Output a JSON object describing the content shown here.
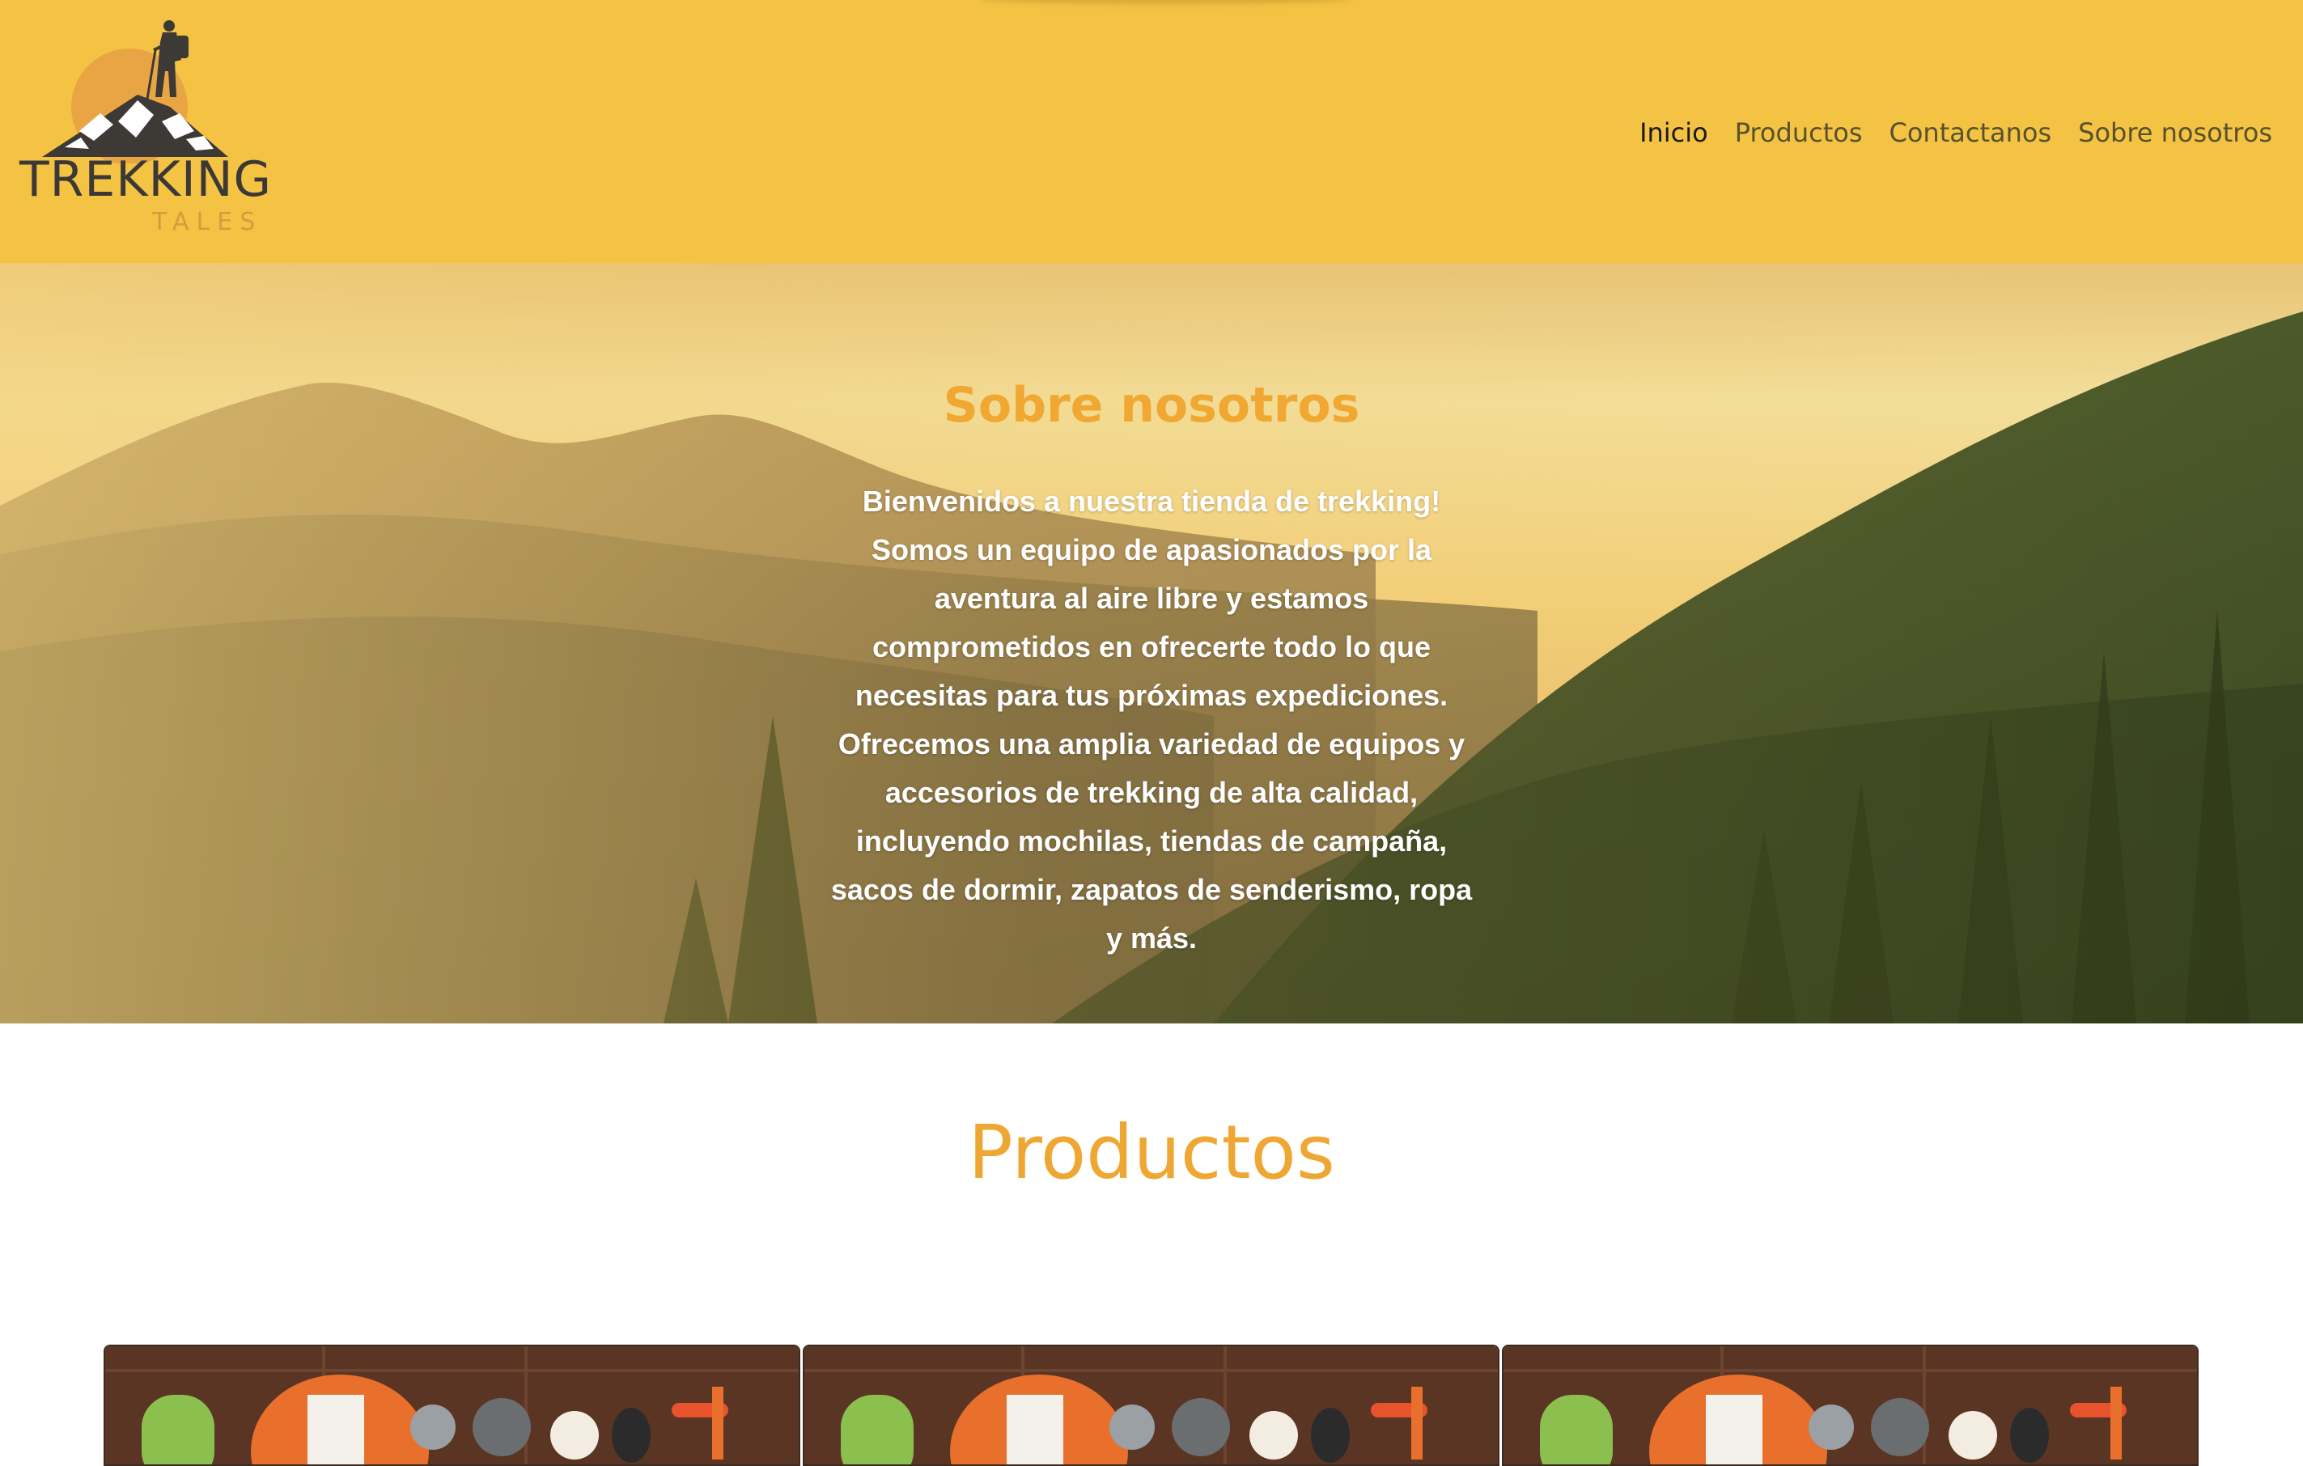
{
  "header": {
    "logo": {
      "title": "TREKKING",
      "subtitle": "TALES"
    },
    "nav": [
      {
        "label": "Inicio",
        "active": true
      },
      {
        "label": "Productos",
        "active": false
      },
      {
        "label": "Contactanos",
        "active": false
      },
      {
        "label": "Sobre nosotros",
        "active": false
      }
    ]
  },
  "hero": {
    "title": "Sobre nosotros",
    "text": "Bienvenidos a nuestra tienda de trekking! Somos un equipo de apasionados por la aventura al aire libre y estamos comprometidos en ofrecerte todo lo que necesitas para tus próximas expediciones. Ofrecemos una amplia variedad de equipos y accesorios de trekking de alta calidad, incluyendo mochilas, tiendas de campaña, sacos de dormir, zapatos de senderismo, ropa y más."
  },
  "products": {
    "title": "Productos",
    "cards": [
      {
        "image": "trekking-gear-photo"
      },
      {
        "image": "trekking-gear-photo"
      },
      {
        "image": "trekking-gear-photo"
      }
    ]
  },
  "colors": {
    "header_bg": "#f4c343",
    "accent": "#efa733",
    "nav_text": "#57512f"
  }
}
